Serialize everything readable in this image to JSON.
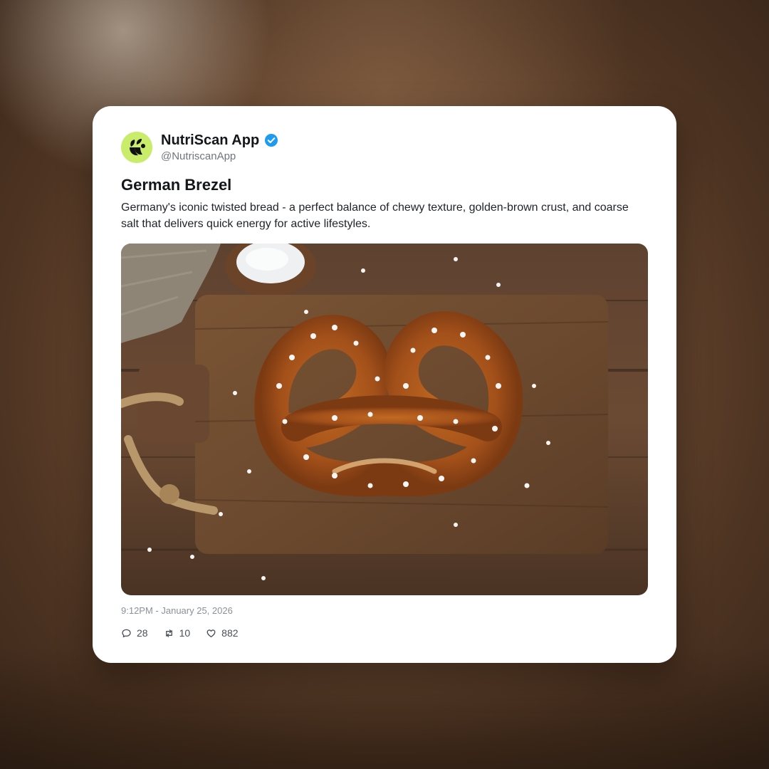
{
  "post": {
    "display_name": "NutriScan App",
    "handle": "@NutriscanApp",
    "verified": true,
    "title": "German Brezel",
    "body": "Germany's iconic twisted bread - a perfect balance of chewy texture, golden-brown crust, and coarse salt that delivers quick energy for active lifestyles.",
    "timestamp": "9:12PM - January 25, 2026",
    "stats": {
      "replies": "28",
      "reposts": "10",
      "likes": "882"
    }
  },
  "icons": {
    "avatar": "leaf-logo-icon",
    "verified": "verified-check-icon",
    "reply": "speech-bubble-icon",
    "repost": "repost-arrows-icon",
    "like": "heart-icon"
  },
  "colors": {
    "avatar_bg": "#c9ed6b",
    "verified": "#1d9bf0",
    "card_bg": "#ffffff"
  }
}
